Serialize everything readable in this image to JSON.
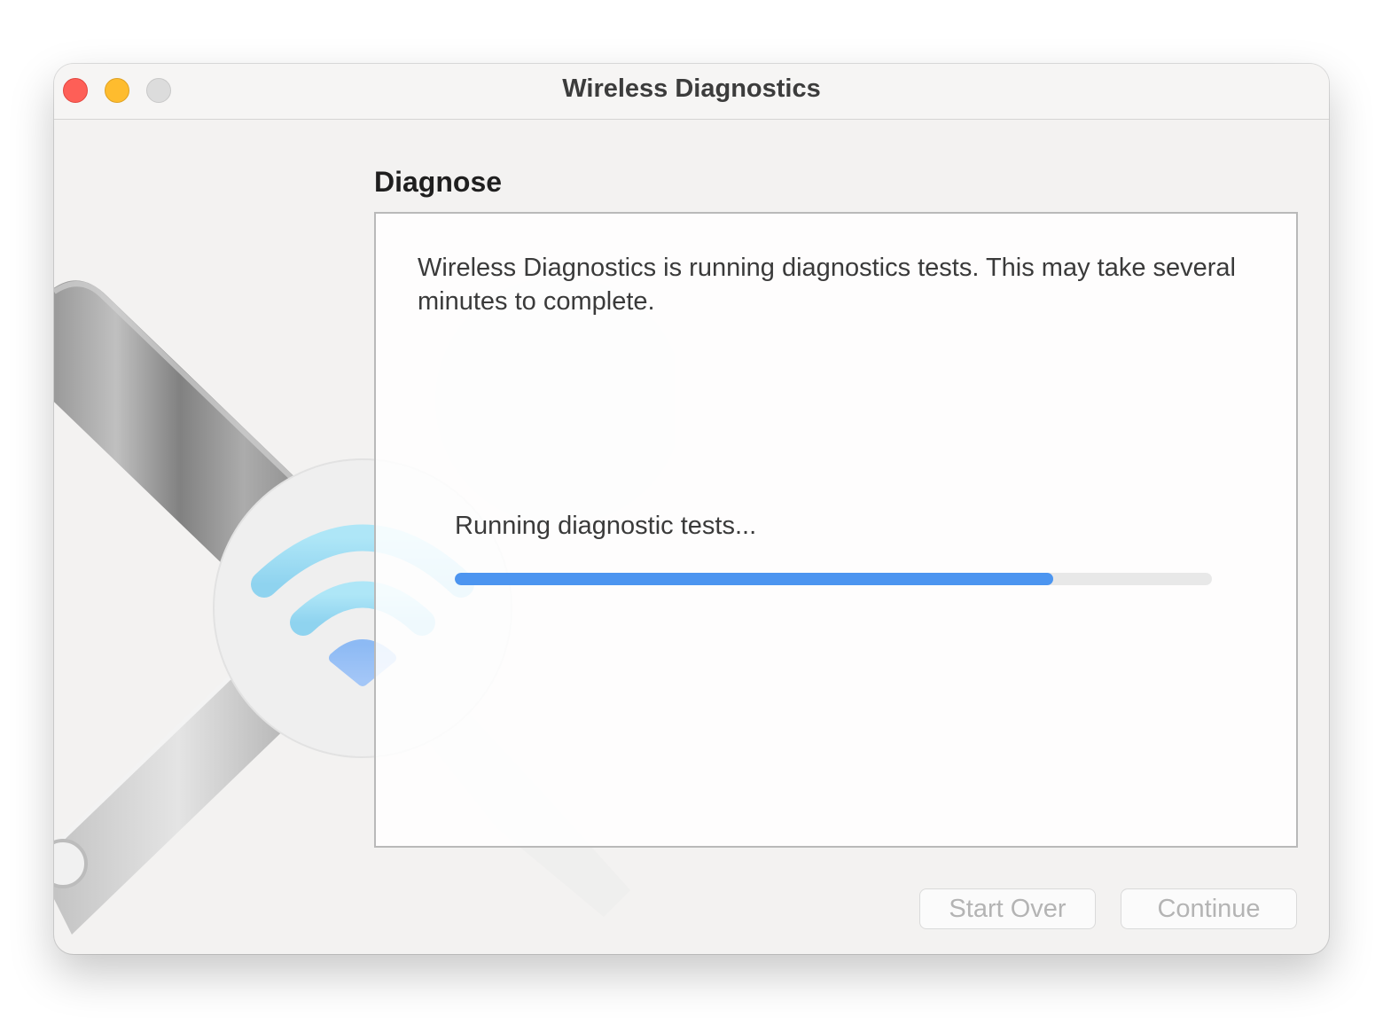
{
  "window": {
    "title": "Wireless Diagnostics"
  },
  "main": {
    "heading": "Diagnose",
    "description": "Wireless Diagnostics is running diagnostics tests. This may take several minutes to complete.",
    "status": "Running diagnostic tests...",
    "progress": 0.79
  },
  "buttons": {
    "start_over": "Start Over",
    "continue": "Continue"
  },
  "colors": {
    "accent": "#4c95f0",
    "close": "#fe5f57",
    "minimize": "#febc2e",
    "zoom_disabled": "#dcdcdc"
  },
  "icons": [
    "wifi-icon",
    "wrench-icon",
    "screwdriver-icon"
  ]
}
